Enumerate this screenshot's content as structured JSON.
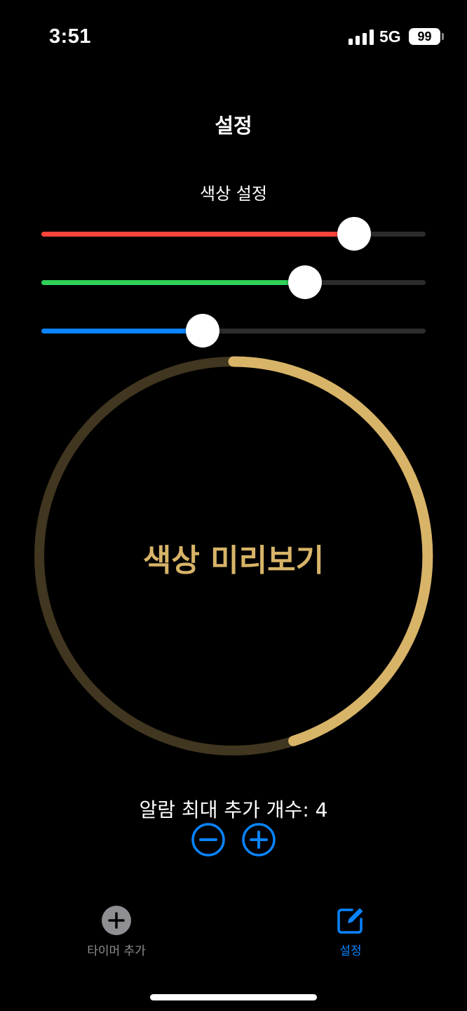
{
  "status_bar": {
    "time": "3:51",
    "network": "5G",
    "battery": "99"
  },
  "header": {
    "title": "설정"
  },
  "color_settings": {
    "title": "색상 설정",
    "sliders": [
      {
        "name": "red",
        "value": 0.814,
        "color": "#ff453a"
      },
      {
        "name": "green",
        "value": 0.686,
        "color": "#30d158"
      },
      {
        "name": "blue",
        "value": 0.42,
        "color": "#0a84ff"
      }
    ]
  },
  "preview": {
    "label": "색상 미리보기",
    "progress": 0.45,
    "color": "#d8b468"
  },
  "alarm": {
    "label": "알람 최대 추가 개수: 4"
  },
  "tabbar": {
    "items": [
      {
        "label": "타이머 추가",
        "icon": "plus-circle-icon"
      },
      {
        "label": "설정",
        "icon": "square-pencil-icon"
      }
    ]
  },
  "colors": {
    "accent": "#0a84ff",
    "inactive_tab": "#8e8e93"
  }
}
